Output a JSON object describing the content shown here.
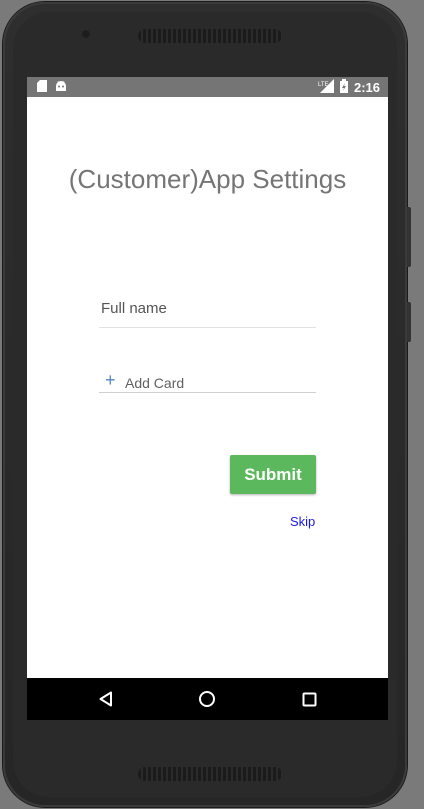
{
  "status_bar": {
    "time": "2:16",
    "left_icons": [
      "sd-card-icon",
      "android-icon"
    ],
    "right_icons": [
      "lte-signal-icon",
      "battery-charging-icon"
    ]
  },
  "screen": {
    "title": "(Customer)App Settings",
    "full_name_placeholder": "Full name",
    "add_card_icon": "plus-icon",
    "add_card_label": "Add Card",
    "submit_label": "Submit",
    "skip_label": "Skip"
  },
  "navigation_bar": {
    "buttons": [
      "back-icon",
      "home-icon",
      "recents-icon"
    ]
  },
  "colors": {
    "status_bar_bg": "#757575",
    "submit_bg": "#5cb85c",
    "skip_link": "#1a1ae6",
    "title_text": "#757575",
    "nav_bar_bg": "#000000"
  }
}
